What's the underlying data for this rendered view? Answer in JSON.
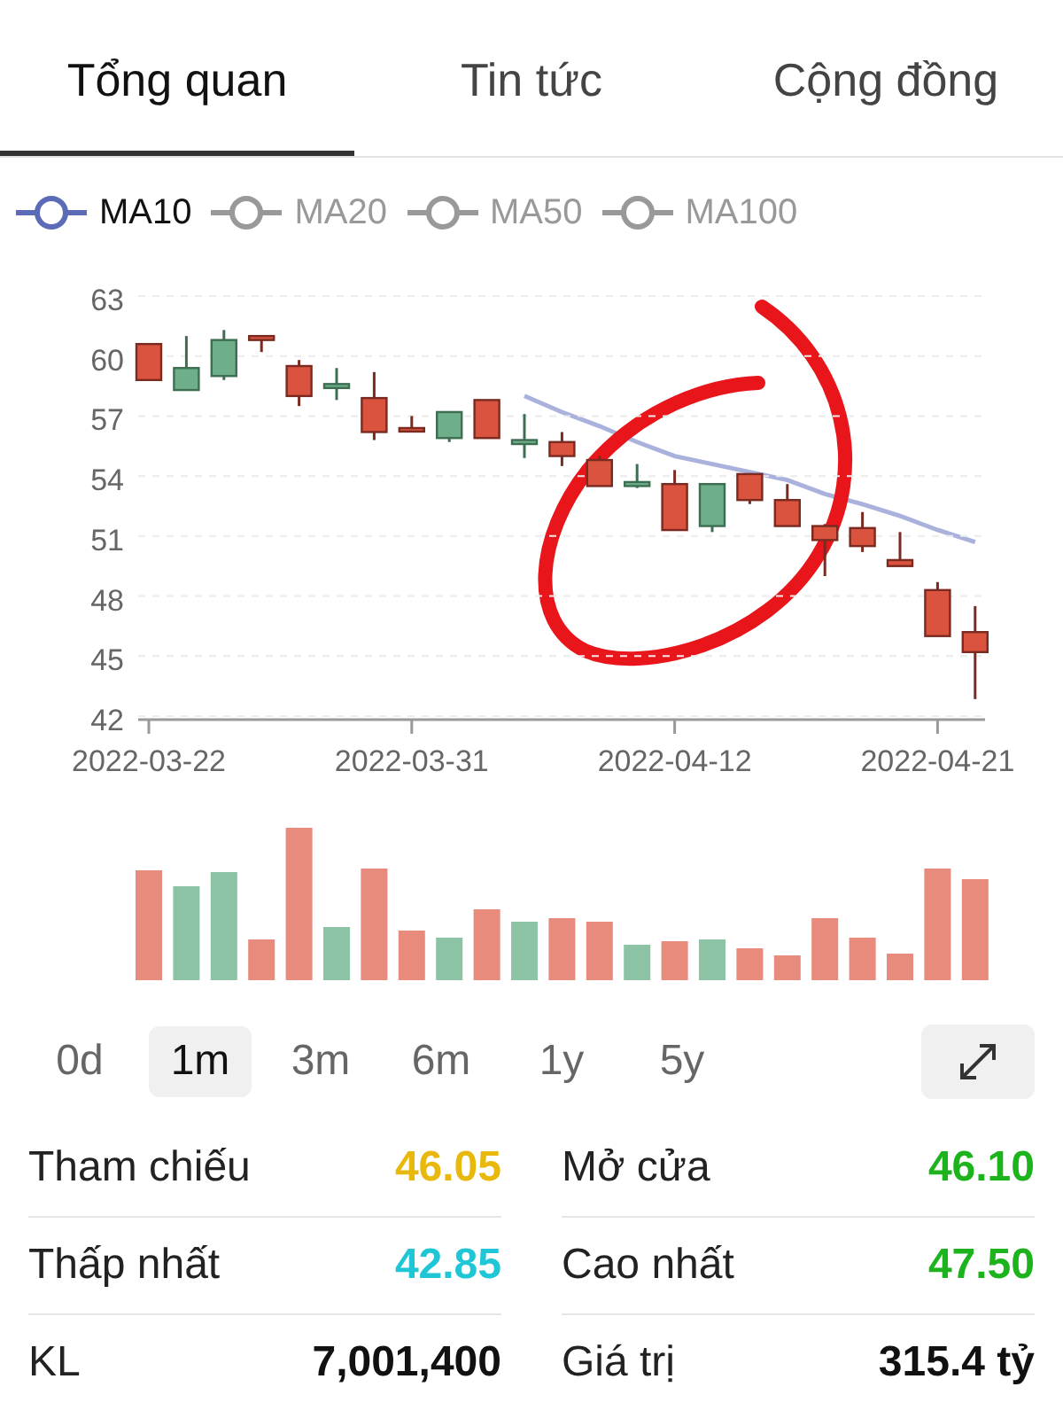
{
  "tabs": [
    {
      "label": "Tổng quan",
      "selected": true
    },
    {
      "label": "Tin tức",
      "selected": false
    },
    {
      "label": "Cộng đồng",
      "selected": false
    }
  ],
  "legend": [
    {
      "label": "MA10",
      "selected": true
    },
    {
      "label": "MA20",
      "selected": false
    },
    {
      "label": "MA50",
      "selected": false
    },
    {
      "label": "MA100",
      "selected": false
    }
  ],
  "price_chart": {
    "chart_data": {
      "type": "candlestick",
      "ylim": [
        42,
        63
      ],
      "yticks": [
        63,
        60,
        57,
        54,
        51,
        48,
        45,
        42
      ],
      "grid": true,
      "categories": [
        "2022-03-22",
        null,
        null,
        null,
        null,
        null,
        null,
        "2022-03-31",
        null,
        null,
        null,
        null,
        null,
        null,
        "2022-04-12",
        null,
        null,
        null,
        null,
        null,
        null,
        "2022-04-21",
        null
      ],
      "ohlc": [
        [
          60.6,
          60.6,
          58.8,
          58.8
        ],
        [
          58.3,
          61,
          58.3,
          59.4
        ],
        [
          59.0,
          61.3,
          58.8,
          60.8
        ],
        [
          61.0,
          61.0,
          60.2,
          60.8
        ],
        [
          59.5,
          59.8,
          57.5,
          58.0
        ],
        [
          58.4,
          59.4,
          57.8,
          58.6
        ],
        [
          57.9,
          59.2,
          55.8,
          56.2
        ],
        [
          56.4,
          57,
          56.3,
          56.3
        ],
        [
          55.9,
          57.2,
          55.7,
          57.2
        ],
        [
          57.8,
          57.8,
          55.9,
          55.9
        ],
        [
          55.6,
          57.1,
          54.9,
          55.8
        ],
        [
          55.7,
          56.2,
          54.5,
          55.0
        ],
        [
          54.8,
          55.0,
          53.5,
          53.5
        ],
        [
          53.5,
          54.6,
          53.4,
          53.7
        ],
        [
          53.6,
          54.3,
          51.3,
          51.3
        ],
        [
          51.5,
          53.6,
          51.2,
          53.6
        ],
        [
          54.1,
          54.1,
          52.6,
          52.8
        ],
        [
          52.8,
          53.6,
          51.5,
          51.5
        ],
        [
          51.5,
          51.6,
          49.0,
          50.8
        ],
        [
          51.4,
          52.2,
          50.2,
          50.5
        ],
        [
          49.8,
          51.2,
          49.5,
          49.5
        ],
        [
          48.3,
          48.7,
          46.0,
          46.0
        ],
        [
          46.2,
          47.5,
          42.85,
          45.2
        ]
      ]
    }
  },
  "periods": [
    {
      "label": "0d",
      "selected": false
    },
    {
      "label": "1m",
      "selected": true
    },
    {
      "label": "3m",
      "selected": false
    },
    {
      "label": "6m",
      "selected": false
    },
    {
      "label": "1y",
      "selected": false
    },
    {
      "label": "5y",
      "selected": false
    }
  ],
  "stats": [
    {
      "label": "Tham chiếu",
      "value": "46.05",
      "color": "#e8b80c"
    },
    {
      "label": "Mở cửa",
      "value": "46.10",
      "color": "#1db31d"
    },
    {
      "label": "Thấp nhất",
      "value": "42.85",
      "color": "#1fc6d6"
    },
    {
      "label": "Cao nhất",
      "value": "47.50",
      "color": "#1db31d"
    },
    {
      "label": "KL",
      "value": "7,001,400",
      "color": "#111111"
    },
    {
      "label": "Giá trị",
      "value": "315.4 tỷ",
      "color": "#111111"
    }
  ]
}
